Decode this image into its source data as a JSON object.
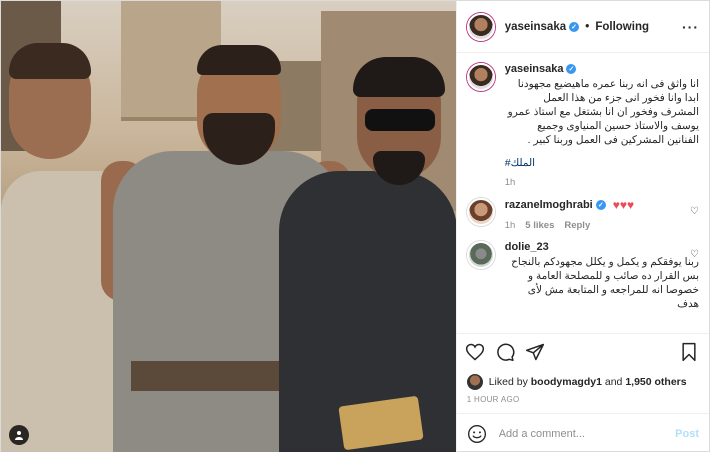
{
  "post": {
    "username": "yaseinsaka",
    "follow_label": "Following",
    "more_icon": "more-icon"
  },
  "caption": {
    "username": "yaseinsaka",
    "text": "انا واثق فى انه ربنا عمره ماهيضيع مجهودنا ابدا وانا فخور انى جزء من هذا العمل المشرف وفخور ان انا بشتغل مع استاذ عمرو يوسف والاستاذ حسين المنياوى وجميع الفنانين المشركين فى العمل وربنا كبير .",
    "hashtag": "#الملك",
    "time": "1h"
  },
  "comments": [
    {
      "username": "razanelmoghrabi",
      "hearts": "♥♥♥",
      "time": "1h",
      "likes": "5 likes",
      "reply": "Reply"
    },
    {
      "username": "dolie_23",
      "text": "ربنا يوفقكم و يكمل و يكلل مجهودكم بالنجاح بس القرار ده صائب و للمصلحة العامة و خصوصا انه للمراجعه و المتابعة مش لأى هدف"
    }
  ],
  "likes": {
    "prefix": "Liked by",
    "user": "boodymagdy1",
    "and": "and",
    "count": "1,950 others"
  },
  "timestamp": "1 HOUR AGO",
  "comment_box": {
    "placeholder": "Add a comment...",
    "post_label": "Post"
  }
}
